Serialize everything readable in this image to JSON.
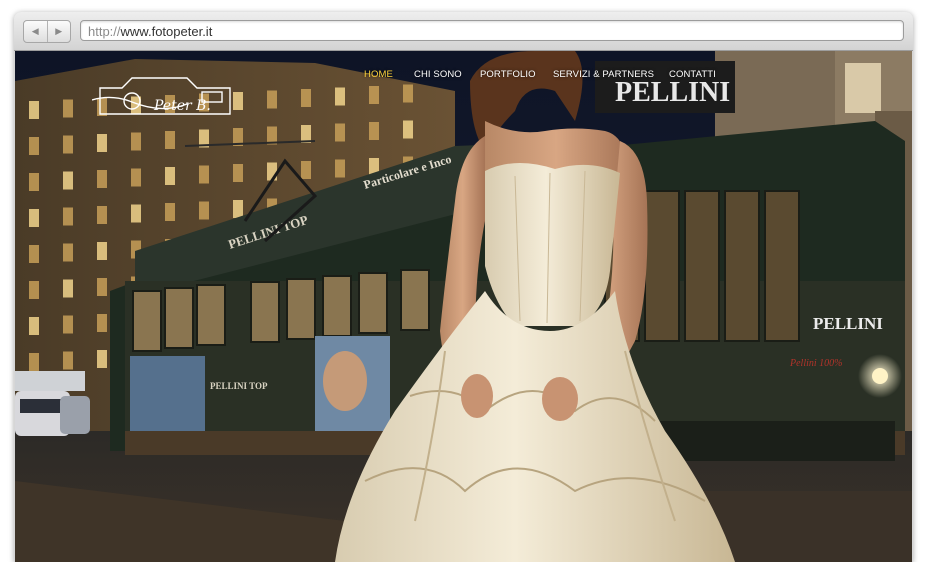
{
  "browser": {
    "back_icon": "back-arrow-icon",
    "forward_icon": "forward-arrow-icon",
    "url_protocol": "http://",
    "url_host": "www.fotopeter.it"
  },
  "site": {
    "logo_text": "Peter B.",
    "nav": [
      {
        "label": "HOME",
        "active": true
      },
      {
        "label": "CHI SONO",
        "active": false
      },
      {
        "label": "PORTFOLIO",
        "active": false
      },
      {
        "label": "SERVIZI & PARTNERS",
        "active": false
      },
      {
        "label": "CONTATTI",
        "active": false
      }
    ],
    "nav_active_color": "#ffd43b",
    "hero": {
      "tram_top_sign": "Particolare e Inco",
      "tram_banner": "PELLINI TOP",
      "tram_ad": "PELLINI TOP",
      "tram_rear_sign": "PELLINI",
      "tram_front_sign": "PELLINI",
      "tram_front_ad": "Pellini 100%",
      "roof_sign": "PELLINI"
    }
  }
}
